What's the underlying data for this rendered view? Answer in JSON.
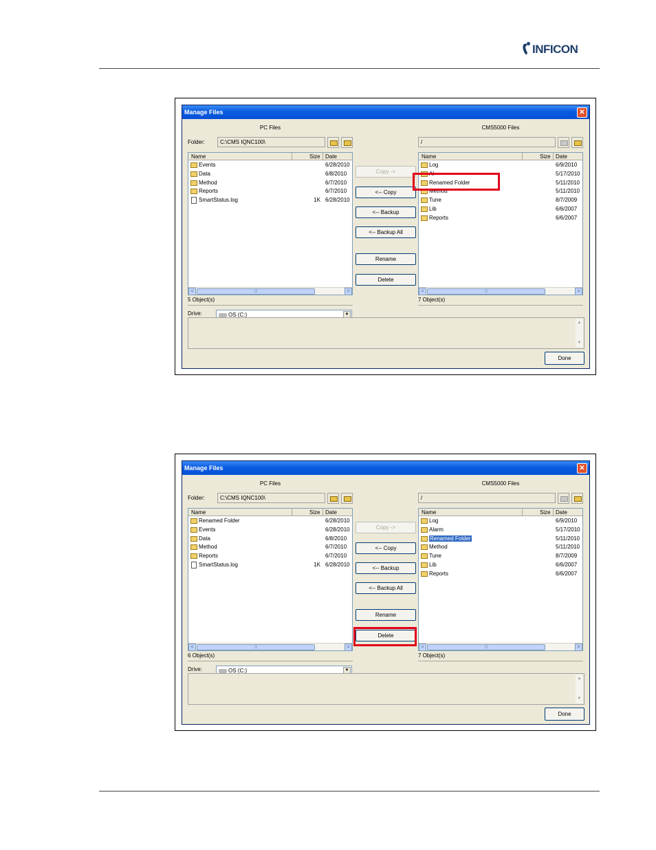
{
  "header": {
    "logo_text": "INFICON"
  },
  "shots": [
    {
      "window": {
        "title": "Manage Files",
        "close": "✕",
        "pc": {
          "title": "PC Files",
          "folder_label": "Folder:",
          "path": "C:\\CMS IQNC100\\",
          "columns": [
            "Name",
            "Size",
            "Date"
          ],
          "rows": [
            {
              "name": "Events",
              "size": "",
              "date": "6/28/2010",
              "type": "folder"
            },
            {
              "name": "Data",
              "size": "",
              "date": "6/8/2010",
              "type": "folder"
            },
            {
              "name": "Method",
              "size": "",
              "date": "6/7/2010",
              "type": "folder"
            },
            {
              "name": "Reports",
              "size": "",
              "date": "6/7/2010",
              "type": "folder"
            },
            {
              "name": "SmartStatus.log",
              "size": "1K",
              "date": "6/28/2010",
              "type": "file"
            }
          ],
          "status": "5 Object(s)",
          "drive_label": "Drive:",
          "drive_value": "OS (C:)"
        },
        "cms": {
          "title": "CMS5000 Files",
          "path": "/",
          "columns": [
            "Name",
            "Size",
            "Date"
          ],
          "rows": [
            {
              "name": "Log",
              "size": "",
              "date": "6/9/2010",
              "type": "folder"
            },
            {
              "name": "Al",
              "size": "",
              "date": "5/17/2010",
              "type": "folder"
            },
            {
              "name": "Renamed Folder",
              "size": "",
              "date": "5/11/2010",
              "type": "folder"
            },
            {
              "name": "Method",
              "size": "",
              "date": "5/11/2010",
              "type": "folder"
            },
            {
              "name": "Tune",
              "size": "",
              "date": "8/7/2009",
              "type": "folder"
            },
            {
              "name": "Lib",
              "size": "",
              "date": "6/6/2007",
              "type": "folder"
            },
            {
              "name": "Reports",
              "size": "",
              "date": "6/6/2007",
              "type": "folder"
            }
          ],
          "status": "7 Object(s)"
        },
        "buttons": {
          "copy_right": "Copy ->",
          "copy_left": "<-- Copy",
          "backup": "<-- Backup",
          "backup_all": "<-- Backup All",
          "rename": "Rename",
          "delete": "Delete",
          "done": "Done"
        }
      }
    },
    {
      "window": {
        "title": "Manage Files",
        "close": "✕",
        "pc": {
          "title": "PC Files",
          "folder_label": "Folder:",
          "path": "C:\\CMS IQNC100\\",
          "columns": [
            "Name",
            "Size",
            "Date"
          ],
          "rows": [
            {
              "name": "Renamed Folder",
              "size": "",
              "date": "6/28/2010",
              "type": "folder"
            },
            {
              "name": "Events",
              "size": "",
              "date": "6/28/2010",
              "type": "folder"
            },
            {
              "name": "Data",
              "size": "",
              "date": "6/8/2010",
              "type": "folder"
            },
            {
              "name": "Method",
              "size": "",
              "date": "6/7/2010",
              "type": "folder"
            },
            {
              "name": "Reports",
              "size": "",
              "date": "6/7/2010",
              "type": "folder"
            },
            {
              "name": "SmartStatus.log",
              "size": "1K",
              "date": "6/28/2010",
              "type": "file"
            }
          ],
          "status": "6 Object(s)",
          "drive_label": "Drive:",
          "drive_value": "OS (C:)"
        },
        "cms": {
          "title": "CMS5000 Files",
          "path": "/",
          "columns": [
            "Name",
            "Size",
            "Date"
          ],
          "rows": [
            {
              "name": "Log",
              "size": "",
              "date": "6/9/2010",
              "type": "folder"
            },
            {
              "name": "Alarm",
              "size": "",
              "date": "5/17/2010",
              "type": "folder"
            },
            {
              "name": "Renamed Folder",
              "size": "",
              "date": "5/11/2010",
              "type": "folder",
              "selected": true
            },
            {
              "name": "Method",
              "size": "",
              "date": "5/11/2010",
              "type": "folder"
            },
            {
              "name": "Tune",
              "size": "",
              "date": "8/7/2009",
              "type": "folder"
            },
            {
              "name": "Lib",
              "size": "",
              "date": "6/6/2007",
              "type": "folder"
            },
            {
              "name": "Reports",
              "size": "",
              "date": "6/6/2007",
              "type": "folder"
            }
          ],
          "status": "7 Object(s)"
        },
        "buttons": {
          "copy_right": "Copy ->",
          "copy_left": "<-- Copy",
          "backup": "<-- Backup",
          "backup_all": "<-- Backup All",
          "rename": "Rename",
          "delete": "Delete",
          "done": "Done"
        }
      }
    }
  ]
}
